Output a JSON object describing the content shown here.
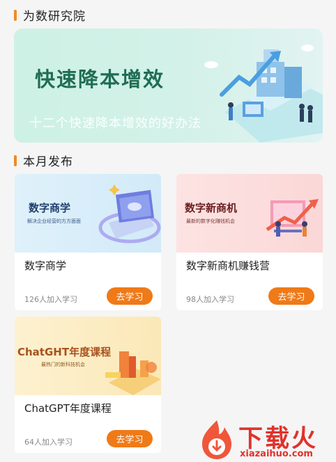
{
  "sections": {
    "institute": "为数研究院",
    "monthly": "本月发布"
  },
  "banner": {
    "headline": "快速降本增效",
    "subtitle": "十二个快速降本增效的好办法"
  },
  "courses": [
    {
      "thumb_title": "数字商学",
      "thumb_subtitle": "解决企业经营的方方面面",
      "title": "数字商学",
      "enrolled": "126人加入学习",
      "button": "去学习"
    },
    {
      "thumb_title": "数字新商机",
      "thumb_subtitle": "最新的数字化赚钱机会",
      "title": "数字新商机赚钱营",
      "enrolled": "98人加入学习",
      "button": "去学习"
    },
    {
      "thumb_title": "ChatGHT年度课程",
      "thumb_subtitle": "最热门的新科技机会",
      "title": "ChatGPT年度课程",
      "enrolled": "64人加入学习",
      "button": "去学习"
    }
  ],
  "watermark": {
    "name": "下载火",
    "url": "xiazaihuo.com"
  },
  "colors": {
    "accent": "#ef7a18",
    "banner_text": "#1f6d54",
    "watermark": "#e0322b"
  }
}
